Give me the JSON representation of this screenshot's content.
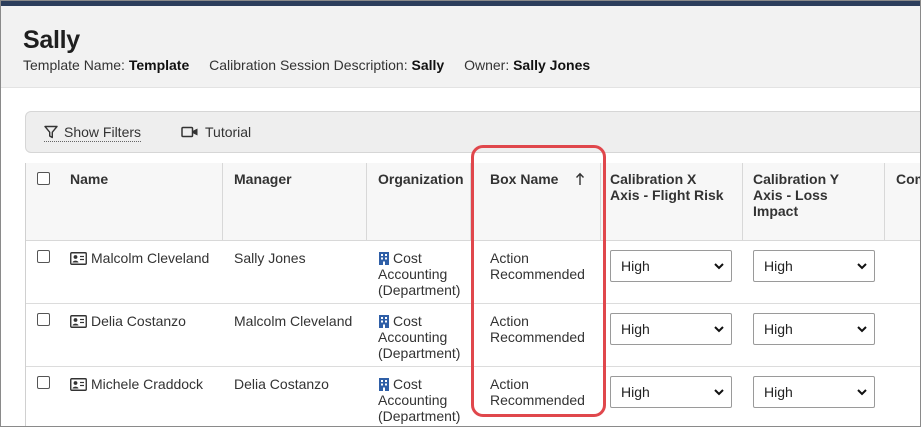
{
  "header": {
    "title": "Sally",
    "meta": [
      {
        "label": "Template Name:",
        "value": "Template"
      },
      {
        "label": "Calibration Session Description:",
        "value": "Sally"
      },
      {
        "label": "Owner:",
        "value": "Sally Jones"
      }
    ]
  },
  "toolbar": {
    "show_filters": "Show Filters",
    "tutorial": "Tutorial"
  },
  "table": {
    "columns": {
      "name": "Name",
      "manager": "Manager",
      "organization": "Organization",
      "box_name": "Box Name",
      "x_axis_1": "Calibration X",
      "x_axis_2": "Axis - Flight Risk",
      "y_axis_1": "Calibration Y",
      "y_axis_2": "Axis - Loss",
      "y_axis_3": "Impact",
      "comments": "Com"
    },
    "rows": [
      {
        "name": "Malcolm Cleveland",
        "manager": "Sally Jones",
        "org_1": "Cost",
        "org_2": "Accounting",
        "org_3": "(Department)",
        "box_1": "Action",
        "box_2": "Recommended",
        "x_value": "High",
        "y_value": "High"
      },
      {
        "name": "Delia Costanzo",
        "manager": "Malcolm Cleveland",
        "org_1": "Cost",
        "org_2": "Accounting",
        "org_3": "(Department)",
        "box_1": "Action",
        "box_2": "Recommended",
        "x_value": "High",
        "y_value": "High"
      },
      {
        "name": "Michele Craddock",
        "manager": "Delia Costanzo",
        "org_1": "Cost",
        "org_2": "Accounting",
        "org_3": "(Department)",
        "box_1": "Action",
        "box_2": "Recommended",
        "x_value": "High",
        "y_value": "High"
      }
    ]
  },
  "colors": {
    "highlight": "#e0474c",
    "building_icon": "#2f5fa7",
    "top_bar": "#2c3e5c"
  }
}
